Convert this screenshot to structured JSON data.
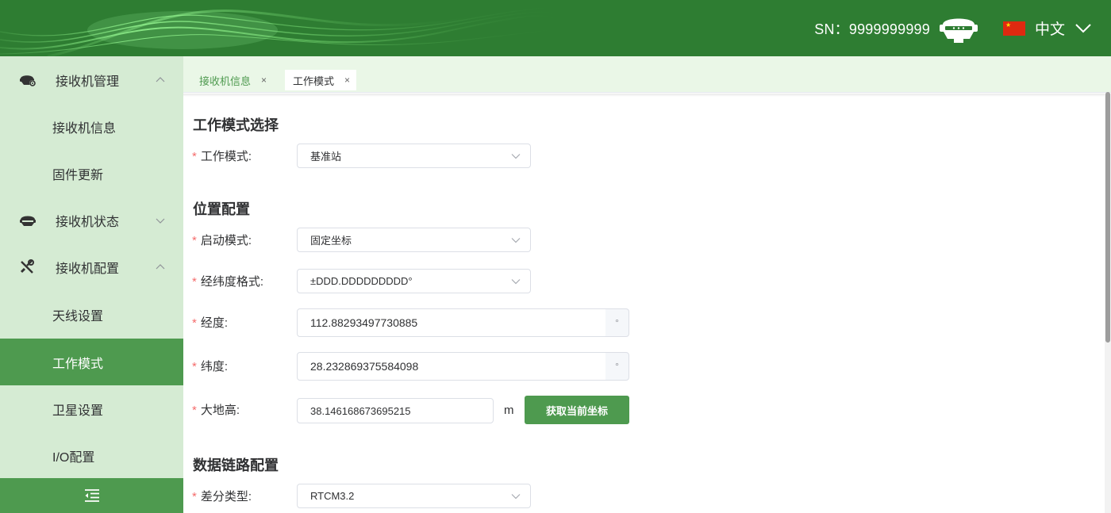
{
  "header": {
    "sn_label": "SN：9999999999",
    "language": "中文",
    "device_icon": "gnss-receiver-icon",
    "flag_icon": "china-flag-icon",
    "brand_color": "#2e7d32"
  },
  "sidebar": {
    "groups": [
      {
        "label": "接收机管理",
        "icon": "receiver-gear-icon",
        "expanded": true
      },
      {
        "label": "接收机状态",
        "icon": "receiver-status-icon",
        "expanded": false
      },
      {
        "label": "接收机配置",
        "icon": "tools-icon",
        "expanded": true
      }
    ],
    "items": [
      {
        "label": "接收机信息"
      },
      {
        "label": "固件更新"
      },
      {
        "label": "天线设置"
      },
      {
        "label": "工作模式",
        "active": true
      },
      {
        "label": "卫星设置"
      },
      {
        "label": "I/O配置"
      }
    ],
    "collapse_icon": "menu-collapse-icon"
  },
  "tabs": [
    {
      "label": "接收机信息",
      "close": "×"
    },
    {
      "label": "工作模式",
      "close": "×",
      "active": true
    }
  ],
  "form": {
    "section_work_mode": "工作模式选择",
    "work_mode_label": "工作模式:",
    "work_mode_value": "基准站",
    "section_position": "位置配置",
    "start_mode_label": "启动模式:",
    "start_mode_value": "固定坐标",
    "format_label": "经纬度格式:",
    "format_value": "±DDD.DDDDDDDDD°",
    "longitude_label": "经度:",
    "longitude_value": "112.88293497730885",
    "longitude_unit": "°",
    "latitude_label": "纬度:",
    "latitude_value": "28.232869375584098",
    "latitude_unit": "°",
    "height_label": "大地高:",
    "height_value": "38.146168673695215",
    "height_unit": "m",
    "get_coord_button": "获取当前坐标",
    "section_datalink": "数据链路配置",
    "diff_type_label": "差分类型:",
    "diff_type_value": "RTCM3.2",
    "required_mark": "*"
  },
  "colors": {
    "accent": "#4e9a4f",
    "sidebar_bg": "#d5ebd3",
    "tabbar_bg": "#eaf7e7",
    "required": "#f56c6c"
  }
}
